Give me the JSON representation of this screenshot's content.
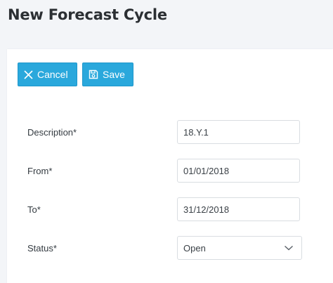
{
  "page": {
    "title": "New Forecast Cycle"
  },
  "toolbar": {
    "cancel_label": "Cancel",
    "save_label": "Save"
  },
  "form": {
    "description": {
      "label": "Description*",
      "value": "18.Y.1"
    },
    "from": {
      "label": "From*",
      "value": "01/01/2018"
    },
    "to": {
      "label": "To*",
      "value": "31/12/2018"
    },
    "status": {
      "label": "Status*",
      "value": "Open"
    }
  },
  "colors": {
    "accent": "#2aa8dc",
    "background": "#f3f5f8",
    "card": "#ffffff"
  },
  "icons": {
    "cancel": "close-icon",
    "save": "save-icon",
    "dropdown": "chevron-down-icon"
  }
}
